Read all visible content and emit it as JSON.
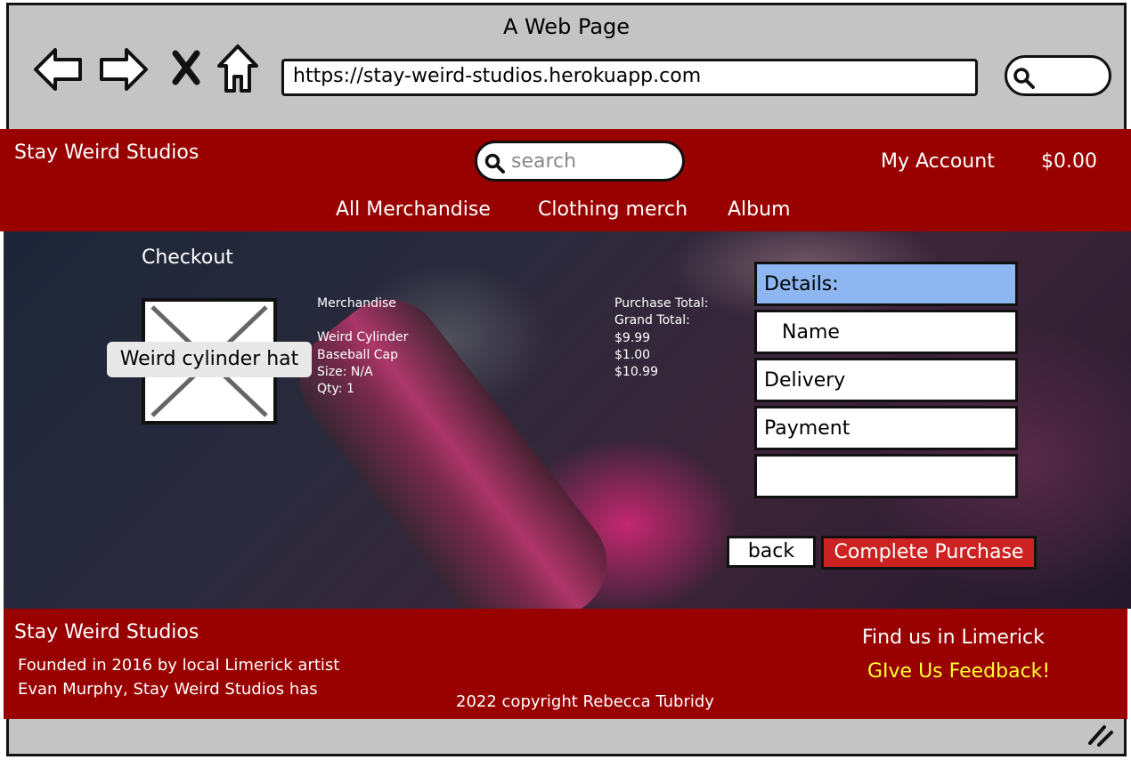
{
  "browser": {
    "title": "A Web Page",
    "url": "https://stay-weird-studios.herokuapp.com",
    "icons": [
      "back-arrow-icon",
      "forward-arrow-icon",
      "close-icon",
      "home-icon",
      "search-icon"
    ]
  },
  "header": {
    "brand": "Stay Weird Studios",
    "search_placeholder": "search",
    "account": "My Account",
    "cart_total": "$0.00",
    "nav": [
      "All Merchandise",
      "Clothing merch",
      "Album"
    ]
  },
  "checkout": {
    "title": "Checkout",
    "image_label": "Weird cylinder hat",
    "merch_heading": "Merchandise",
    "item_name_line1": "Weird Cylinder",
    "item_name_line2": "Baseball Cap",
    "size": "Size: N/A",
    "qty": "Qty: 1",
    "purchase_total_label": "Purchase Total:",
    "grand_total_label": "Grand Total:",
    "price": "$9.99",
    "shipping": "$1.00",
    "grand_total": "$10.99",
    "details": {
      "heading": "Details:",
      "name": "Name",
      "delivery": "Delivery",
      "payment": "Payment",
      "extra": ""
    },
    "back_label": "back",
    "complete_label": "Complete Purchase"
  },
  "footer": {
    "brand": "Stay Weird Studios",
    "about_line1": "Founded in 2016 by local Limerick artist",
    "about_line2": "Evan Murphy, Stay Weird Studios has",
    "copyright": "2022 copyright Rebecca Tubridy",
    "find_us": "Find us in Limerick",
    "feedback": "GIve Us Feedback!"
  },
  "colors": {
    "brand_red": "#990000",
    "chrome_grey": "#c4c4c4",
    "details_head": "#8eb6f0",
    "complete_button": "#cc2222",
    "feedback_yellow": "#ffff33"
  }
}
